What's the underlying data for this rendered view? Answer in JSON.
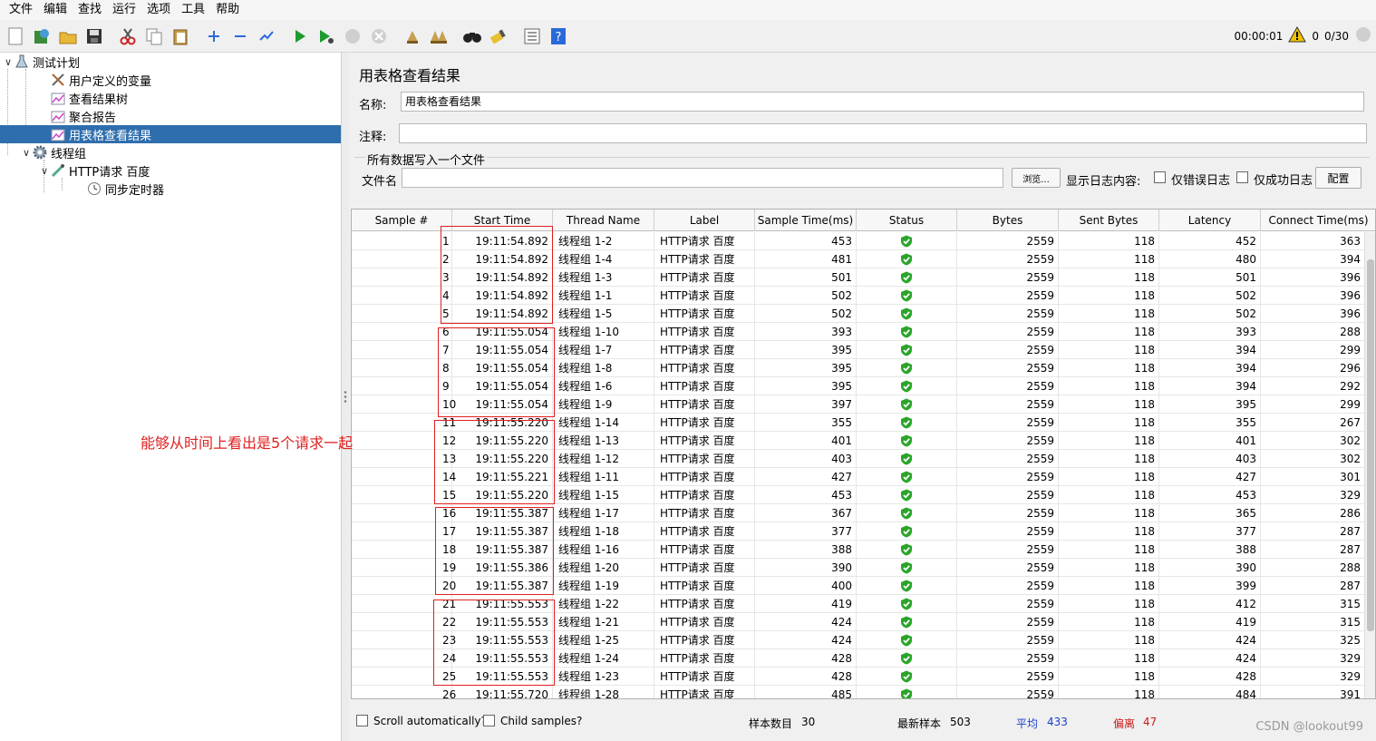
{
  "menu": [
    "文件",
    "编辑",
    "查找",
    "运行",
    "选项",
    "工具",
    "帮助"
  ],
  "toolbar": {
    "elapsed": "00:00:01",
    "warn_count": "0",
    "threads": "0/30"
  },
  "tree": {
    "items": [
      {
        "label": "测试计划",
        "icon": "flask-icon"
      },
      {
        "label": "用户定义的变量",
        "icon": "tools-icon"
      },
      {
        "label": "查看结果树",
        "icon": "chart-icon"
      },
      {
        "label": "聚合报告",
        "icon": "chart-icon"
      },
      {
        "label": "用表格查看结果",
        "icon": "chart-icon"
      },
      {
        "label": "线程组",
        "icon": "gear-icon"
      },
      {
        "label": "HTTP请求 百度",
        "icon": "pipette-icon"
      },
      {
        "label": "同步定时器",
        "icon": "clock-icon"
      }
    ]
  },
  "panel": {
    "title": "用表格查看结果",
    "name_label": "名称:",
    "name_value": "用表格查看结果",
    "comment_label": "注释:",
    "comment_value": "",
    "group_title": "所有数据写入一个文件",
    "filename_label": "文件名",
    "filename_value": "",
    "browse_label": "浏览...",
    "log_label": "显示日志内容:",
    "errors_only_label": "仅错误日志",
    "success_only_label": "仅成功日志",
    "config_label": "配置"
  },
  "table": {
    "columns": [
      "Sample #",
      "Start Time",
      "Thread Name",
      "Label",
      "Sample Time(ms)",
      "Status",
      "Bytes",
      "Sent Bytes",
      "Latency",
      "Connect Time(ms)"
    ],
    "rows": [
      [
        "1",
        "19:11:54.892",
        "线程组 1-2",
        "HTTP请求 百度",
        "453",
        "ok",
        "2559",
        "118",
        "452",
        "363"
      ],
      [
        "2",
        "19:11:54.892",
        "线程组 1-4",
        "HTTP请求 百度",
        "481",
        "ok",
        "2559",
        "118",
        "480",
        "394"
      ],
      [
        "3",
        "19:11:54.892",
        "线程组 1-3",
        "HTTP请求 百度",
        "501",
        "ok",
        "2559",
        "118",
        "501",
        "396"
      ],
      [
        "4",
        "19:11:54.892",
        "线程组 1-1",
        "HTTP请求 百度",
        "502",
        "ok",
        "2559",
        "118",
        "502",
        "396"
      ],
      [
        "5",
        "19:11:54.892",
        "线程组 1-5",
        "HTTP请求 百度",
        "502",
        "ok",
        "2559",
        "118",
        "502",
        "396"
      ],
      [
        "6",
        "19:11:55.054",
        "线程组 1-10",
        "HTTP请求 百度",
        "393",
        "ok",
        "2559",
        "118",
        "393",
        "288"
      ],
      [
        "7",
        "19:11:55.054",
        "线程组 1-7",
        "HTTP请求 百度",
        "395",
        "ok",
        "2559",
        "118",
        "394",
        "299"
      ],
      [
        "8",
        "19:11:55.054",
        "线程组 1-8",
        "HTTP请求 百度",
        "395",
        "ok",
        "2559",
        "118",
        "394",
        "296"
      ],
      [
        "9",
        "19:11:55.054",
        "线程组 1-6",
        "HTTP请求 百度",
        "395",
        "ok",
        "2559",
        "118",
        "394",
        "292"
      ],
      [
        "10",
        "19:11:55.054",
        "线程组 1-9",
        "HTTP请求 百度",
        "397",
        "ok",
        "2559",
        "118",
        "395",
        "299"
      ],
      [
        "11",
        "19:11:55.220",
        "线程组 1-14",
        "HTTP请求 百度",
        "355",
        "ok",
        "2559",
        "118",
        "355",
        "267"
      ],
      [
        "12",
        "19:11:55.220",
        "线程组 1-13",
        "HTTP请求 百度",
        "401",
        "ok",
        "2559",
        "118",
        "401",
        "302"
      ],
      [
        "13",
        "19:11:55.220",
        "线程组 1-12",
        "HTTP请求 百度",
        "403",
        "ok",
        "2559",
        "118",
        "403",
        "302"
      ],
      [
        "14",
        "19:11:55.221",
        "线程组 1-11",
        "HTTP请求 百度",
        "427",
        "ok",
        "2559",
        "118",
        "427",
        "301"
      ],
      [
        "15",
        "19:11:55.220",
        "线程组 1-15",
        "HTTP请求 百度",
        "453",
        "ok",
        "2559",
        "118",
        "453",
        "329"
      ],
      [
        "16",
        "19:11:55.387",
        "线程组 1-17",
        "HTTP请求 百度",
        "367",
        "ok",
        "2559",
        "118",
        "365",
        "286"
      ],
      [
        "17",
        "19:11:55.387",
        "线程组 1-18",
        "HTTP请求 百度",
        "377",
        "ok",
        "2559",
        "118",
        "377",
        "287"
      ],
      [
        "18",
        "19:11:55.387",
        "线程组 1-16",
        "HTTP请求 百度",
        "388",
        "ok",
        "2559",
        "118",
        "388",
        "287"
      ],
      [
        "19",
        "19:11:55.386",
        "线程组 1-20",
        "HTTP请求 百度",
        "390",
        "ok",
        "2559",
        "118",
        "390",
        "288"
      ],
      [
        "20",
        "19:11:55.387",
        "线程组 1-19",
        "HTTP请求 百度",
        "400",
        "ok",
        "2559",
        "118",
        "399",
        "287"
      ],
      [
        "21",
        "19:11:55.553",
        "线程组 1-22",
        "HTTP请求 百度",
        "419",
        "ok",
        "2559",
        "118",
        "412",
        "315"
      ],
      [
        "22",
        "19:11:55.553",
        "线程组 1-21",
        "HTTP请求 百度",
        "424",
        "ok",
        "2559",
        "118",
        "419",
        "315"
      ],
      [
        "23",
        "19:11:55.553",
        "线程组 1-25",
        "HTTP请求 百度",
        "424",
        "ok",
        "2559",
        "118",
        "424",
        "325"
      ],
      [
        "24",
        "19:11:55.553",
        "线程组 1-24",
        "HTTP请求 百度",
        "428",
        "ok",
        "2559",
        "118",
        "424",
        "329"
      ],
      [
        "25",
        "19:11:55.553",
        "线程组 1-23",
        "HTTP请求 百度",
        "428",
        "ok",
        "2559",
        "118",
        "428",
        "329"
      ],
      [
        "26",
        "19:11:55.720",
        "线程组 1-28",
        "HTTP请求 百度",
        "485",
        "ok",
        "2559",
        "118",
        "484",
        "391"
      ]
    ]
  },
  "annotation": "能够从时间上看出是5个请求一起",
  "bottom": {
    "scroll_label": "Scroll automatically?",
    "child_label": "Child samples?",
    "count_label": "样本数目",
    "count_value": "30",
    "latest_label": "最新样本",
    "latest_value": "503",
    "avg_label": "平均",
    "avg_value": "433",
    "dev_label": "偏离",
    "dev_value": "47",
    "avg_color": "#1a3fcc",
    "dev_color": "#cc1a1a"
  },
  "watermark": "CSDN @lookout99",
  "colors": {
    "selection": "#2f6ead",
    "annotation": "#e02020",
    "status_ok": "#2aa52a"
  }
}
